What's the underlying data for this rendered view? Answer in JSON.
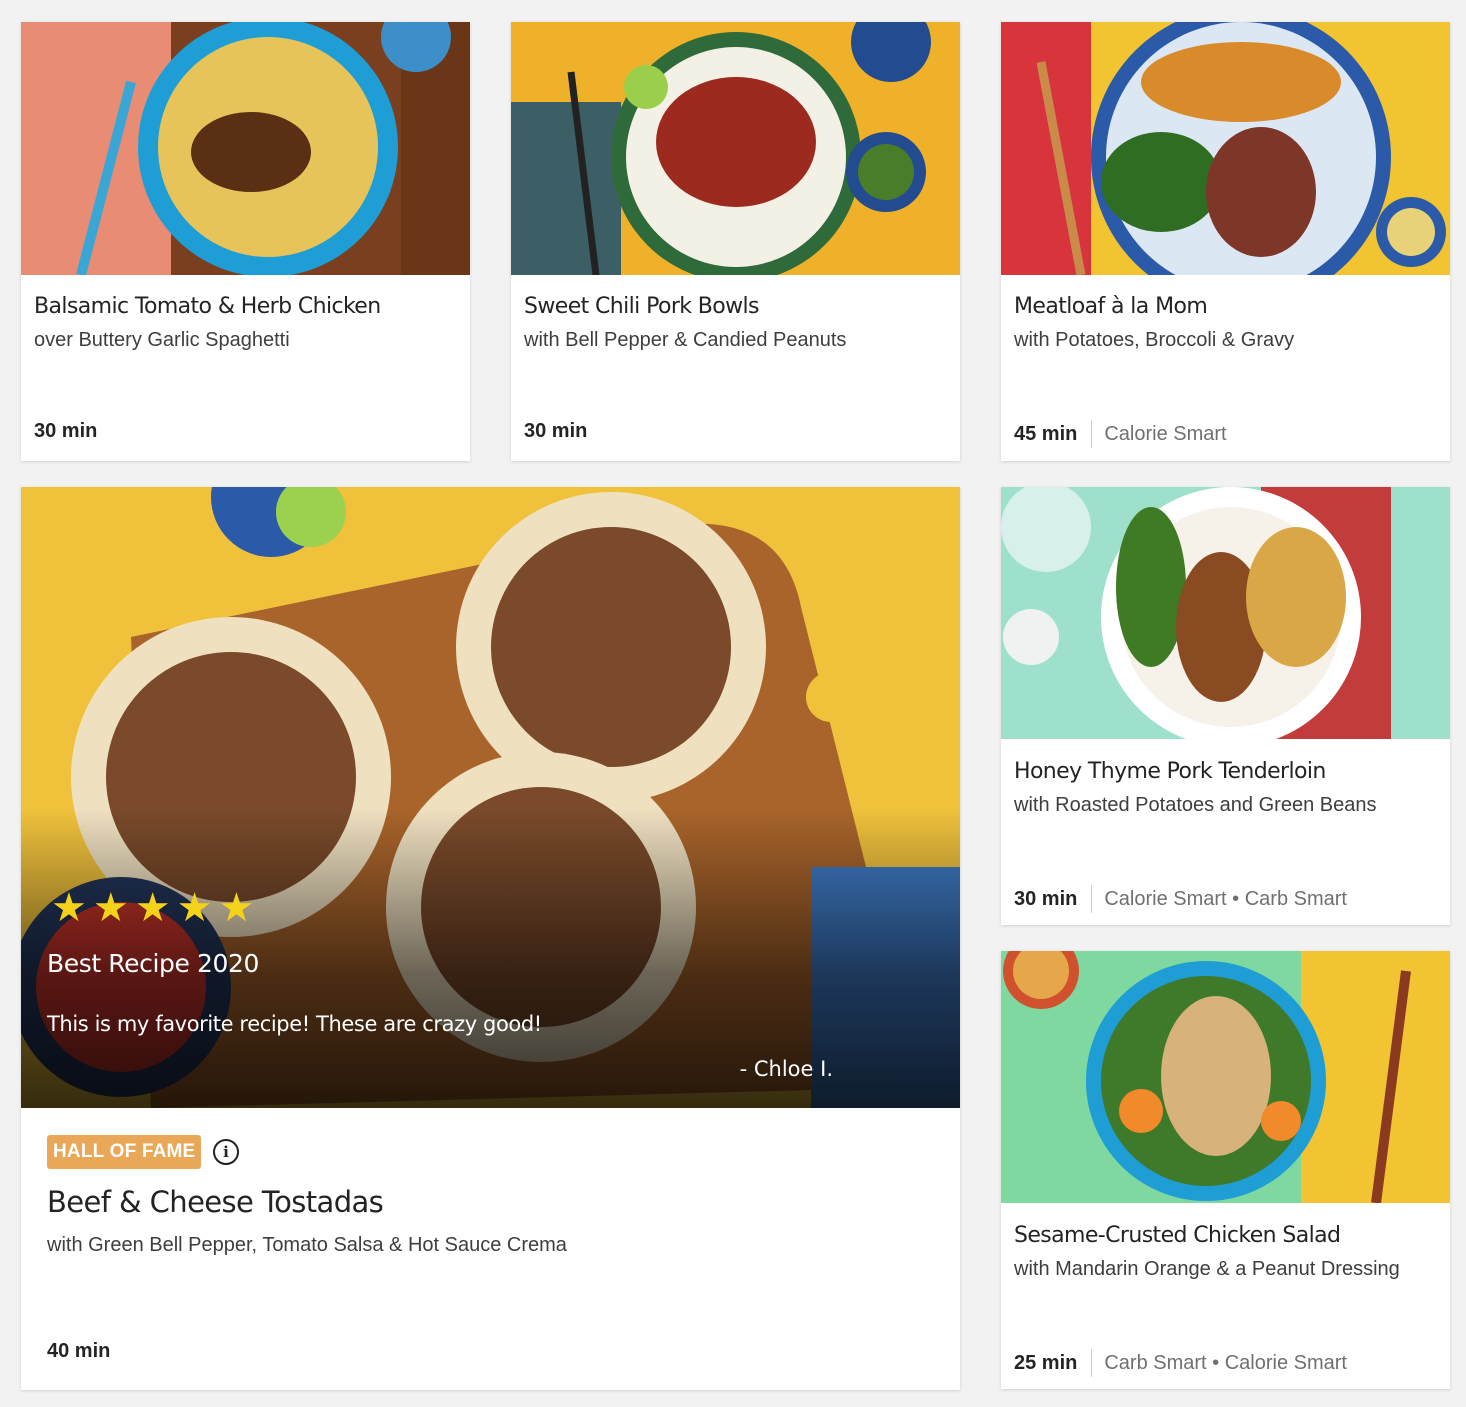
{
  "recipes": [
    {
      "title": "Balsamic Tomato & Herb Chicken",
      "subtitle": "over Buttery Garlic Spaghetti",
      "time": "30 min",
      "tags": "",
      "image": "spaghetti-chicken-bowl"
    },
    {
      "title": "Sweet Chili Pork Bowls",
      "subtitle": "with Bell Pepper & Candied Peanuts",
      "time": "30 min",
      "tags": "",
      "image": "pork-rice-bowl"
    },
    {
      "title": "Meatloaf à la Mom",
      "subtitle": "with Potatoes, Broccoli & Gravy",
      "time": "45 min",
      "tags": "Calorie Smart",
      "image": "meatloaf-plate"
    },
    {
      "title": "Honey Thyme Pork Tenderloin",
      "subtitle": "with Roasted Potatoes and Green Beans",
      "time": "30 min",
      "tags": "Calorie Smart • Carb Smart",
      "image": "pork-tenderloin-plate"
    },
    {
      "title": "Sesame-Crusted Chicken Salad",
      "subtitle": "with Mandarin Orange & a Peanut Dressing",
      "time": "25 min",
      "tags": "Carb Smart • Calorie Smart",
      "image": "chicken-salad-bowl"
    }
  ],
  "featured": {
    "badge": "HALL OF FAME",
    "title": "Beef & Cheese Tostadas",
    "subtitle": "with Green Bell Pepper, Tomato Salsa & Hot Sauce Crema",
    "time": "40 min",
    "rating_stars": 5,
    "stars": "★★★★★",
    "review_title": "Best Recipe 2020",
    "review_quote": "This is my favorite recipe! These are crazy good!",
    "review_author": "- Chloe I.",
    "image": "tostadas-on-board",
    "info_icon": "info-icon"
  },
  "colors": {
    "badge": "#e8a857",
    "star": "#f5d21a",
    "page_bg": "#f2f2f2"
  }
}
